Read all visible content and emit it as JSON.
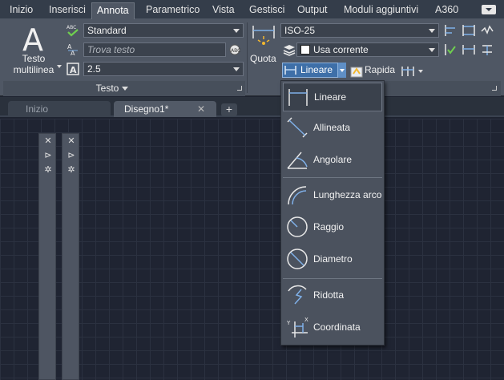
{
  "ribbon_tabs": [
    {
      "label": "Inizio"
    },
    {
      "label": "Inserisci"
    },
    {
      "label": "Annota",
      "active": true
    },
    {
      "label": "Parametrico"
    },
    {
      "label": "Vista"
    },
    {
      "label": "Gestisci"
    },
    {
      "label": "Output"
    },
    {
      "label": "Moduli aggiuntivi"
    },
    {
      "label": "A360"
    }
  ],
  "text_panel": {
    "big_button_label": "Testo multilinea",
    "style_value": "Standard",
    "search_placeholder": "Trova testo",
    "height_value": "2.5",
    "title": "Testo"
  },
  "dim_panel": {
    "quota_label": "Quota",
    "dimstyle_value": "ISO-25",
    "layer_value": "Usa corrente",
    "linear_button_label": "Lineare",
    "rapid_label": "Rapida"
  },
  "file_tabs": [
    {
      "label": "Inizio",
      "active": false
    },
    {
      "label": "Disegno1*",
      "active": true
    }
  ],
  "dimension_menu": {
    "items": [
      {
        "label": "Lineare",
        "icon": "linear-dim-icon",
        "selected": true
      },
      {
        "label": "Allineata",
        "icon": "aligned-dim-icon"
      },
      {
        "label": "Angolare",
        "icon": "angular-dim-icon"
      },
      {
        "label": "Lunghezza arco",
        "icon": "arc-length-icon"
      },
      {
        "label": "Raggio",
        "icon": "radius-icon"
      },
      {
        "label": "Diametro",
        "icon": "diameter-icon"
      },
      {
        "label": "Ridotta",
        "icon": "jogged-icon"
      },
      {
        "label": "Coordinata",
        "icon": "ordinate-icon"
      }
    ]
  },
  "colors": {
    "ribbon_bg": "#4f5764",
    "tabbar_bg": "#343d4a",
    "canvas_bg": "#1f2432",
    "accent_blue": "#3e6fa8",
    "icon_blue": "#7fb0e8"
  }
}
